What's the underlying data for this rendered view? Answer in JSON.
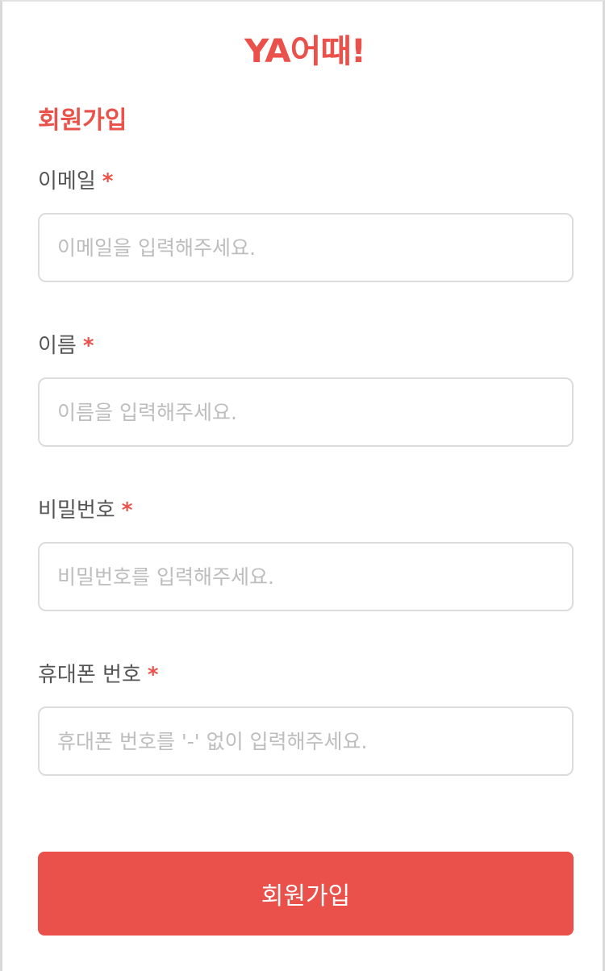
{
  "brand": {
    "logo_text": "YA어때!",
    "accent_color": "#ea514a"
  },
  "page": {
    "title": "회원가입"
  },
  "form": {
    "required_mark": "*",
    "fields": [
      {
        "label": "이메일",
        "placeholder": "이메일을 입력해주세요.",
        "value": ""
      },
      {
        "label": "이름",
        "placeholder": "이름을 입력해주세요.",
        "value": ""
      },
      {
        "label": "비밀번호",
        "placeholder": "비밀번호를 입력해주세요.",
        "value": ""
      },
      {
        "label": "휴대폰 번호",
        "placeholder": "휴대폰 번호를 '-' 없이 입력해주세요.",
        "value": ""
      }
    ],
    "submit_label": "회원가입"
  }
}
